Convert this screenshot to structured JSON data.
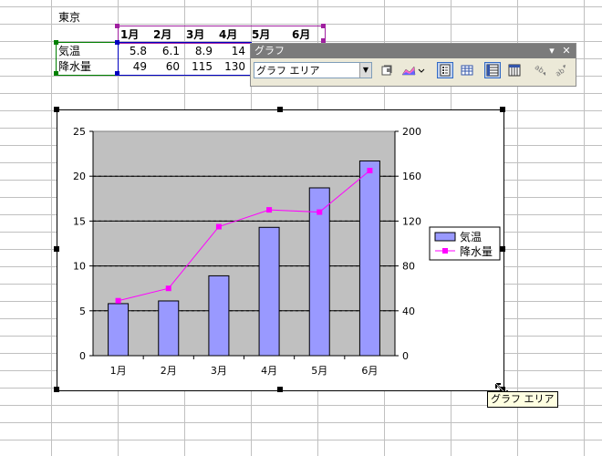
{
  "sheet": {
    "title": "東京",
    "months": [
      "1月",
      "2月",
      "3月",
      "4月",
      "5月",
      "6月"
    ],
    "row_labels": [
      "気温",
      "降水量"
    ],
    "temperature": [
      "5.8",
      "6.1",
      "8.9",
      "14"
    ],
    "precipitation": [
      "49",
      "60",
      "115",
      "130"
    ]
  },
  "toolbar": {
    "title": "グラフ",
    "dropdown_icon": "dropdown-arrow-icon",
    "close_icon": "close-icon",
    "selected_object": "グラフ エリア",
    "buttons": [
      "format-selected-object-icon",
      "chart-type-icon",
      "legend-icon",
      "data-table-icon",
      "by-row-icon",
      "by-column-icon",
      "angle-text-downward-icon",
      "angle-text-upward-icon"
    ]
  },
  "tooltip": "グラフ エリア",
  "colors": {
    "bars": "#9999ff",
    "line": "#ff00ff",
    "plot_bg": "#c0c0c0",
    "toolbar_title": "#7b7b7b"
  },
  "chart_data": {
    "type": "bar",
    "categories": [
      "1月",
      "2月",
      "3月",
      "4月",
      "5月",
      "6月"
    ],
    "series": [
      {
        "name": "気温",
        "type": "bar",
        "axis": "left",
        "values": [
          5.8,
          6.1,
          8.9,
          14.3,
          18.7,
          21.7
        ]
      },
      {
        "name": "降水量",
        "type": "line",
        "axis": "right",
        "values": [
          49,
          60,
          115,
          130,
          128,
          165
        ]
      }
    ],
    "ylim": [
      0,
      25
    ],
    "y_ticks": [
      "0",
      "5",
      "10",
      "15",
      "20",
      "25"
    ],
    "y2lim": [
      0,
      200
    ],
    "y2_ticks": [
      "0",
      "40",
      "80",
      "120",
      "160",
      "200"
    ],
    "grid": true,
    "legend": "right"
  }
}
